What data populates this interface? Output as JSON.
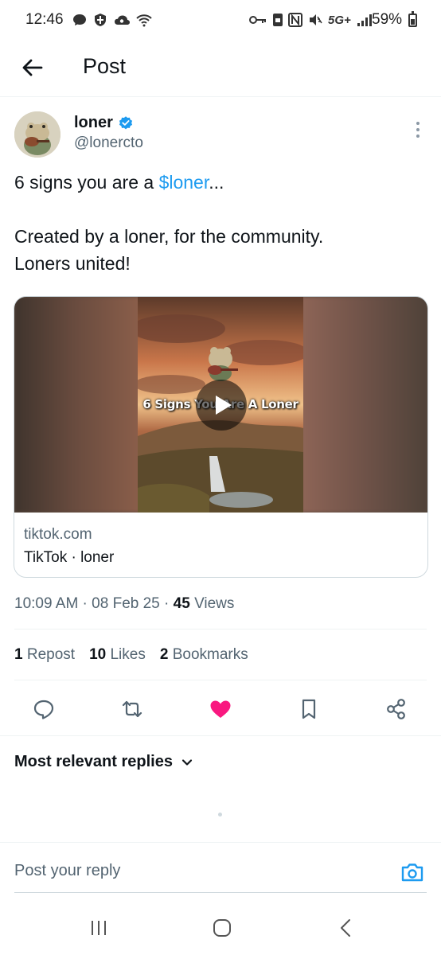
{
  "status_bar": {
    "time": "12:46",
    "network": "5G+",
    "battery": "59%"
  },
  "header": {
    "title": "Post"
  },
  "post": {
    "author_name": "loner",
    "author_handle": "@lonercto",
    "text_prefix": "6 signs you are a ",
    "cashtag": "$loner",
    "text_suffix": "...",
    "line2": "Created by a loner, for the community.",
    "line3": "Loners united!",
    "card": {
      "overlay_text": "6 Signs You Are A Loner",
      "domain": "tiktok.com",
      "title": "TikTok · loner"
    },
    "time": "10:09 AM",
    "date": "08 Feb 25",
    "views_count": "45",
    "views_label": "Views",
    "reposts_count": "1",
    "reposts_label": "Repost",
    "likes_count": "10",
    "likes_label": "Likes",
    "bookmarks_count": "2",
    "bookmarks_label": "Bookmarks",
    "liked": true
  },
  "replies": {
    "sort_label": "Most relevant replies",
    "reply_placeholder": "Post your reply"
  },
  "colors": {
    "accent": "#1d9bf0",
    "like": "#f91880",
    "muted": "#536471"
  },
  "icons": {
    "back": "arrow-left-icon",
    "verified": "verified-badge-icon",
    "more": "more-vertical-icon",
    "reply": "reply-icon",
    "repost": "repost-icon",
    "like": "heart-icon",
    "bookmark": "bookmark-icon",
    "share": "share-icon",
    "camera": "camera-icon"
  }
}
